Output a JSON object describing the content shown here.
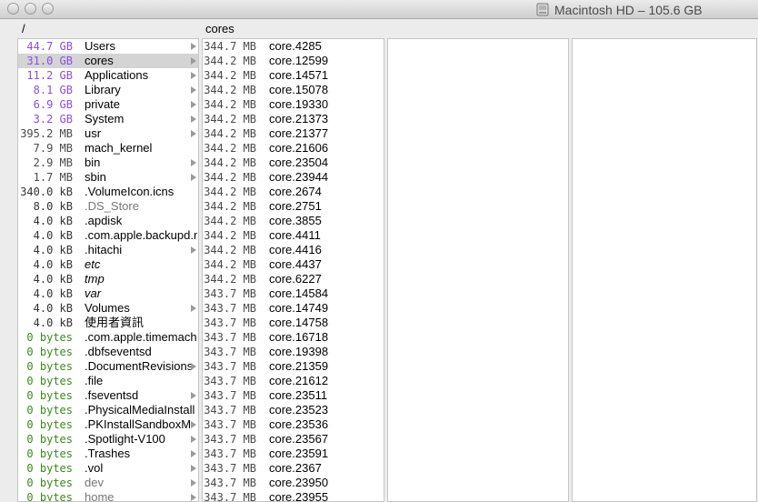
{
  "window": {
    "title": "Macintosh HD – 105.6 GB"
  },
  "colors": {
    "gb": "#8a4fe0",
    "mb": "#4a4a4a",
    "kb": "#333333",
    "bytes": "#3c8a1e",
    "selection": "#d4d4d4"
  },
  "columns": {
    "root": {
      "header": "/"
    },
    "cores": {
      "header": "cores"
    }
  },
  "root_items": [
    {
      "size": "44.7 GB",
      "unit": "gb",
      "name": "Users",
      "arrow": true
    },
    {
      "size": "31.0 GB",
      "unit": "gb",
      "name": "cores",
      "arrow": true,
      "selected": true
    },
    {
      "size": "11.2 GB",
      "unit": "gb",
      "name": "Applications",
      "arrow": true
    },
    {
      "size": "8.1 GB",
      "unit": "gb",
      "name": "Library",
      "arrow": true
    },
    {
      "size": "6.9 GB",
      "unit": "gb",
      "name": "private",
      "arrow": true
    },
    {
      "size": "3.2 GB",
      "unit": "gb",
      "name": "System",
      "arrow": true
    },
    {
      "size": "395.2 MB",
      "unit": "mb",
      "name": "usr",
      "arrow": true
    },
    {
      "size": "7.9 MB",
      "unit": "mb",
      "name": "mach_kernel",
      "arrow": false
    },
    {
      "size": "2.9 MB",
      "unit": "mb",
      "name": "bin",
      "arrow": true
    },
    {
      "size": "1.7 MB",
      "unit": "mb",
      "name": "sbin",
      "arrow": true
    },
    {
      "size": "340.0 kB",
      "unit": "kb",
      "name": ".VolumeIcon.icns",
      "arrow": false
    },
    {
      "size": "8.0 kB",
      "unit": "kb",
      "name": ".DS_Store",
      "arrow": false,
      "style": "hidden"
    },
    {
      "size": "4.0 kB",
      "unit": "kb",
      "name": ".apdisk",
      "arrow": false
    },
    {
      "size": "4.0 kB",
      "unit": "kb",
      "name": ".com.apple.backupd.m",
      "arrow": false
    },
    {
      "size": "4.0 kB",
      "unit": "kb",
      "name": ".hitachi",
      "arrow": true
    },
    {
      "size": "4.0 kB",
      "unit": "kb",
      "name": "etc",
      "arrow": false,
      "style": "italic"
    },
    {
      "size": "4.0 kB",
      "unit": "kb",
      "name": "tmp",
      "arrow": false,
      "style": "italic"
    },
    {
      "size": "4.0 kB",
      "unit": "kb",
      "name": "var",
      "arrow": false,
      "style": "italic"
    },
    {
      "size": "4.0 kB",
      "unit": "kb",
      "name": "Volumes",
      "arrow": true
    },
    {
      "size": "4.0 kB",
      "unit": "kb",
      "name": "使用者資訊",
      "arrow": false
    },
    {
      "size": "0 bytes",
      "unit": "bytes",
      "name": ".com.apple.timemach",
      "arrow": false
    },
    {
      "size": "0 bytes",
      "unit": "bytes",
      "name": ".dbfseventsd",
      "arrow": false
    },
    {
      "size": "0 bytes",
      "unit": "bytes",
      "name": ".DocumentRevisions",
      "arrow": true
    },
    {
      "size": "0 bytes",
      "unit": "bytes",
      "name": ".file",
      "arrow": false
    },
    {
      "size": "0 bytes",
      "unit": "bytes",
      "name": ".fseventsd",
      "arrow": true
    },
    {
      "size": "0 bytes",
      "unit": "bytes",
      "name": ".PhysicalMediaInstall",
      "arrow": false
    },
    {
      "size": "0 bytes",
      "unit": "bytes",
      "name": ".PKInstallSandboxM",
      "arrow": true
    },
    {
      "size": "0 bytes",
      "unit": "bytes",
      "name": ".Spotlight-V100",
      "arrow": true
    },
    {
      "size": "0 bytes",
      "unit": "bytes",
      "name": ".Trashes",
      "arrow": true
    },
    {
      "size": "0 bytes",
      "unit": "bytes",
      "name": ".vol",
      "arrow": true
    },
    {
      "size": "0 bytes",
      "unit": "bytes",
      "name": "dev",
      "arrow": true,
      "style": "hidden"
    },
    {
      "size": "0 bytes",
      "unit": "bytes",
      "name": "home",
      "arrow": true,
      "style": "hidden"
    }
  ],
  "core_items": [
    {
      "size": "344.7 MB",
      "name": "core.4285"
    },
    {
      "size": "344.2 MB",
      "name": "core.12599"
    },
    {
      "size": "344.2 MB",
      "name": "core.14571"
    },
    {
      "size": "344.2 MB",
      "name": "core.15078"
    },
    {
      "size": "344.2 MB",
      "name": "core.19330"
    },
    {
      "size": "344.2 MB",
      "name": "core.21373"
    },
    {
      "size": "344.2 MB",
      "name": "core.21377"
    },
    {
      "size": "344.2 MB",
      "name": "core.21606"
    },
    {
      "size": "344.2 MB",
      "name": "core.23504"
    },
    {
      "size": "344.2 MB",
      "name": "core.23944"
    },
    {
      "size": "344.2 MB",
      "name": "core.2674"
    },
    {
      "size": "344.2 MB",
      "name": "core.2751"
    },
    {
      "size": "344.2 MB",
      "name": "core.3855"
    },
    {
      "size": "344.2 MB",
      "name": "core.4411"
    },
    {
      "size": "344.2 MB",
      "name": "core.4416"
    },
    {
      "size": "344.2 MB",
      "name": "core.4437"
    },
    {
      "size": "344.2 MB",
      "name": "core.6227"
    },
    {
      "size": "343.7 MB",
      "name": "core.14584"
    },
    {
      "size": "343.7 MB",
      "name": "core.14749"
    },
    {
      "size": "343.7 MB",
      "name": "core.14758"
    },
    {
      "size": "343.7 MB",
      "name": "core.16718"
    },
    {
      "size": "343.7 MB",
      "name": "core.19398"
    },
    {
      "size": "343.7 MB",
      "name": "core.21359"
    },
    {
      "size": "343.7 MB",
      "name": "core.21612"
    },
    {
      "size": "343.7 MB",
      "name": "core.23511"
    },
    {
      "size": "343.7 MB",
      "name": "core.23523"
    },
    {
      "size": "343.7 MB",
      "name": "core.23536"
    },
    {
      "size": "343.7 MB",
      "name": "core.23567"
    },
    {
      "size": "343.7 MB",
      "name": "core.23591"
    },
    {
      "size": "343.7 MB",
      "name": "core.2367"
    },
    {
      "size": "343.7 MB",
      "name": "core.23950"
    },
    {
      "size": "343.7 MB",
      "name": "core.23955"
    }
  ]
}
